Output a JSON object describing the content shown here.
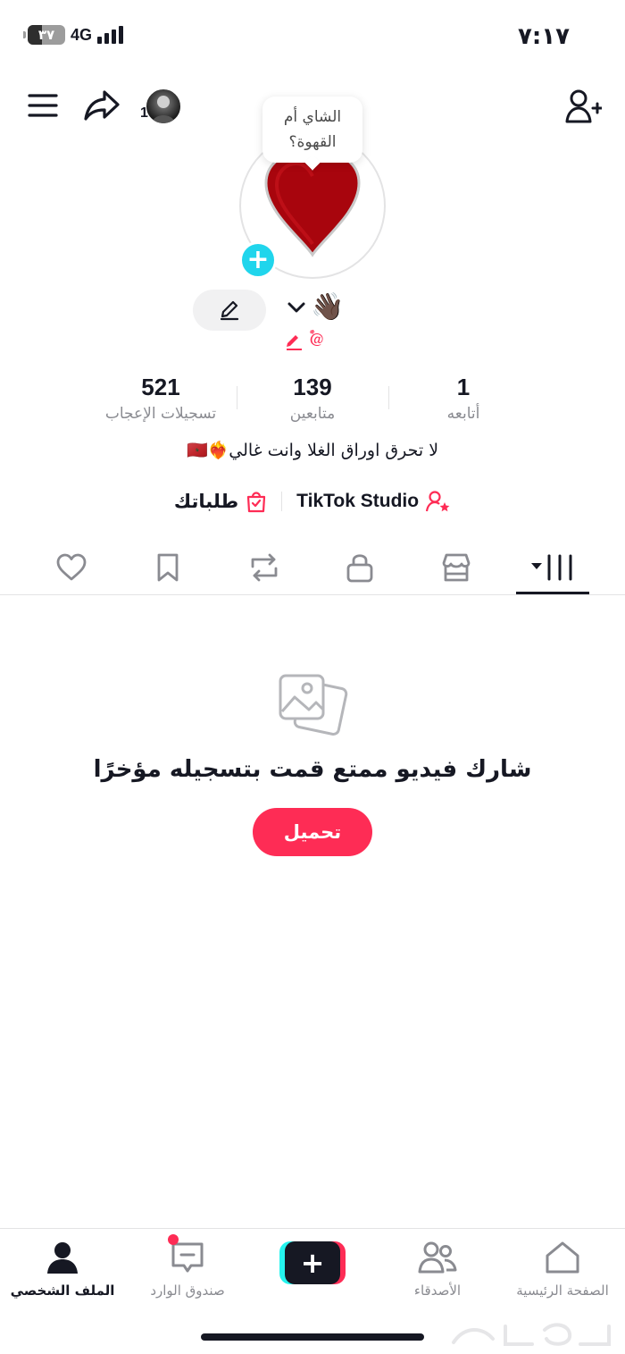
{
  "status_bar": {
    "time": "٧:١٧",
    "battery": "٣٧",
    "battery_level": 0.37,
    "network": "4G"
  },
  "top_bar": {
    "switch_account_count": "1"
  },
  "profile": {
    "note_bubble": "الشاي أم القهوة؟",
    "name_emoji": "👋🏿",
    "handle": "@ٌٌ۟",
    "edit_icon": "pencil-icon",
    "stats": {
      "following": {
        "value": "1",
        "label": "أتابعه"
      },
      "followers": {
        "value": "139",
        "label": "متابعين"
      },
      "likes": {
        "value": "521",
        "label": "تسجيلات الإعجاب"
      }
    },
    "bio": "لا تحرق اوراق الغلا وانت غالي❤️‍🔥🇲🇦",
    "studio_label": "TikTok Studio",
    "orders_label": "طلباتك"
  },
  "tabs": [
    {
      "name": "videos",
      "icon": "grid-icon",
      "active": true
    },
    {
      "name": "shop",
      "icon": "shop-icon"
    },
    {
      "name": "private",
      "icon": "lock-icon"
    },
    {
      "name": "reposts",
      "icon": "repost-icon"
    },
    {
      "name": "favorites",
      "icon": "bookmark-icon"
    },
    {
      "name": "liked",
      "icon": "heart-icon"
    }
  ],
  "empty_state": {
    "icon": "photos-icon",
    "title": "شارك فيديو ممتع قمت بتسجيله مؤخرًا",
    "button": "تحميل"
  },
  "bottom_nav": {
    "home": "الصفحة الرئيسية",
    "friends": "الأصدقاء",
    "create": "+",
    "inbox": "صندوق الوارد",
    "profile": "الملف الشخصي"
  },
  "colors": {
    "accent": "#fe2c55",
    "cyan": "#25f4ee",
    "add_badge": "#20d5ec",
    "text": "#161823",
    "muted": "#8a8b91"
  }
}
